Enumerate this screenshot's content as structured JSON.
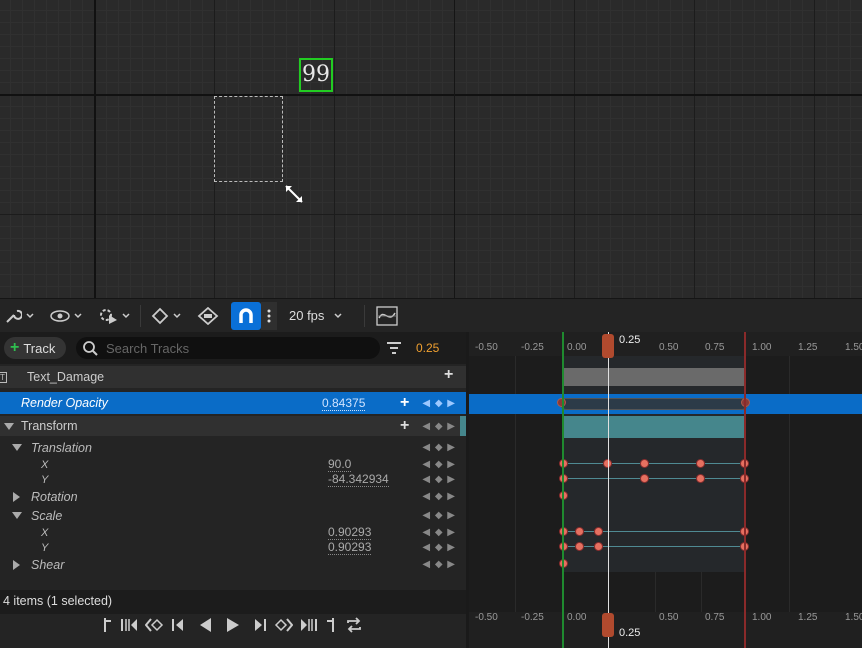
{
  "viewport": {
    "widget_text": "99"
  },
  "toolbar": {
    "fps_label": "20 fps"
  },
  "tracks_panel": {
    "add_track_label": "Track",
    "search_placeholder": "Search Tracks",
    "current_time": "0.25",
    "rows": {
      "text_damage": "Text_Damage",
      "render_opacity": {
        "label": "Render Opacity",
        "value": "0.84375"
      },
      "transform": "Transform",
      "translation": "Translation",
      "translation_x": {
        "label": "X",
        "value": "90.0"
      },
      "translation_y": {
        "label": "Y",
        "value": "-84.342934"
      },
      "rotation": "Rotation",
      "scale": "Scale",
      "scale_x": {
        "label": "X",
        "value": "0.90293"
      },
      "scale_y": {
        "label": "Y",
        "value": "0.90293"
      },
      "shear": "Shear"
    },
    "status": "4 items (1 selected)"
  },
  "timeline": {
    "ruler_labels": [
      "-0.50",
      "-0.25",
      "0.00",
      "0.50",
      "0.75",
      "1.00",
      "1.25",
      "1.50"
    ],
    "playhead_time": "0.25"
  },
  "colors": {
    "accent": "#0a70d8",
    "selection": "#0a6cc7",
    "playhead_handle": "#b04a2e",
    "key": "#e67060",
    "start_marker": "#1f8a2f",
    "end_marker": "#8a2a2a",
    "current_time": "#f0a030"
  }
}
